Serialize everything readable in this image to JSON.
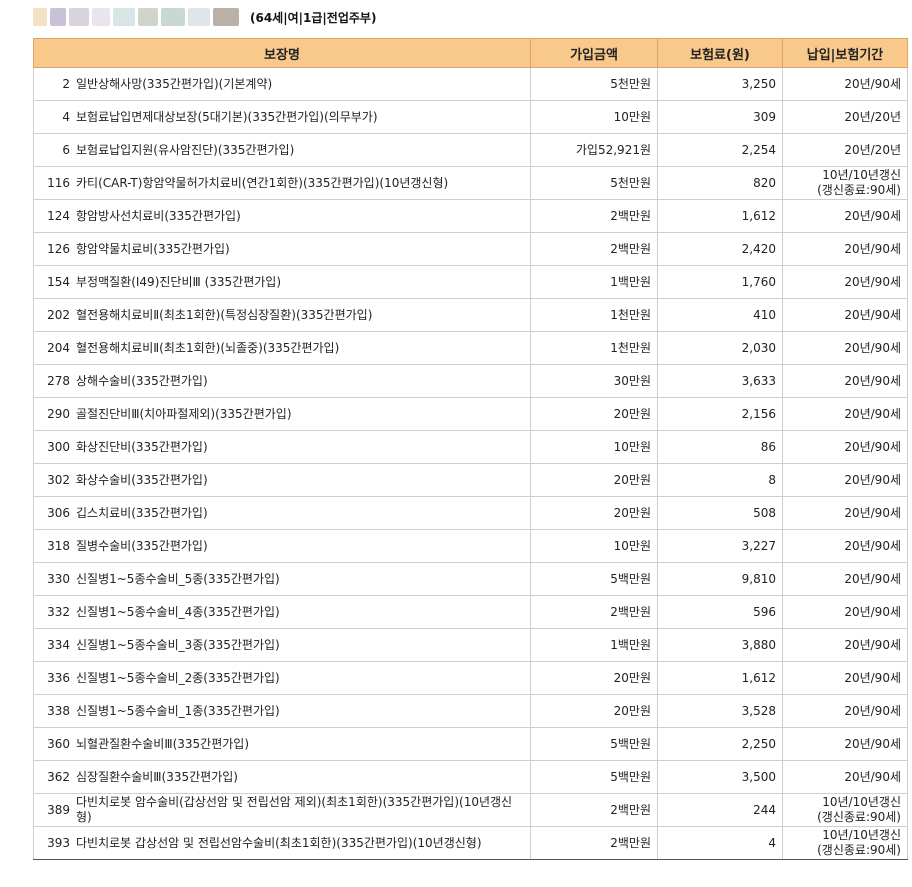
{
  "header": {
    "profile_text": "(64세|여|1급|전업주부)"
  },
  "table": {
    "columns": [
      "보장명",
      "가입금액",
      "보험료(원)",
      "납입|보험기간"
    ],
    "rows": [
      {
        "code": "2",
        "name": "일반상해사망(335간편가입)(기본계약)",
        "amount": "5천만원",
        "premium": "3,250",
        "period": "20년/90세",
        "period2": ""
      },
      {
        "code": "4",
        "name": "보험료납입면제대상보장(5대기본)(335간편가입)(의무부가)",
        "amount": "10만원",
        "premium": "309",
        "period": "20년/20년",
        "period2": ""
      },
      {
        "code": "6",
        "name": "보험료납입지원(유사암진단)(335간편가입)",
        "amount": "가입52,921원",
        "premium": "2,254",
        "period": "20년/20년",
        "period2": ""
      },
      {
        "code": "116",
        "name": "카티(CAR-T)항암약물허가치료비(연간1회한)(335간편가입)(10년갱신형)",
        "amount": "5천만원",
        "premium": "820",
        "period": "10년/10년갱신",
        "period2": "(갱신종료:90세)"
      },
      {
        "code": "124",
        "name": "항암방사선치료비(335간편가입)",
        "amount": "2백만원",
        "premium": "1,612",
        "period": "20년/90세",
        "period2": ""
      },
      {
        "code": "126",
        "name": "항암약물치료비(335간편가입)",
        "amount": "2백만원",
        "premium": "2,420",
        "period": "20년/90세",
        "period2": ""
      },
      {
        "code": "154",
        "name": "부정맥질환(I49)진단비Ⅲ (335간편가입)",
        "amount": "1백만원",
        "premium": "1,760",
        "period": "20년/90세",
        "period2": ""
      },
      {
        "code": "202",
        "name": "혈전용해치료비Ⅱ(최초1회한)(특정심장질환)(335간편가입)",
        "amount": "1천만원",
        "premium": "410",
        "period": "20년/90세",
        "period2": ""
      },
      {
        "code": "204",
        "name": "혈전용해치료비Ⅱ(최초1회한)(뇌졸중)(335간편가입)",
        "amount": "1천만원",
        "premium": "2,030",
        "period": "20년/90세",
        "period2": ""
      },
      {
        "code": "278",
        "name": "상해수술비(335간편가입)",
        "amount": "30만원",
        "premium": "3,633",
        "period": "20년/90세",
        "period2": ""
      },
      {
        "code": "290",
        "name": "골절진단비Ⅲ(치아파절제외)(335간편가입)",
        "amount": "20만원",
        "premium": "2,156",
        "period": "20년/90세",
        "period2": ""
      },
      {
        "code": "300",
        "name": "화상진단비(335간편가입)",
        "amount": "10만원",
        "premium": "86",
        "period": "20년/90세",
        "period2": ""
      },
      {
        "code": "302",
        "name": "화상수술비(335간편가입)",
        "amount": "20만원",
        "premium": "8",
        "period": "20년/90세",
        "period2": ""
      },
      {
        "code": "306",
        "name": "깁스치료비(335간편가입)",
        "amount": "20만원",
        "premium": "508",
        "period": "20년/90세",
        "period2": ""
      },
      {
        "code": "318",
        "name": "질병수술비(335간편가입)",
        "amount": "10만원",
        "premium": "3,227",
        "period": "20년/90세",
        "period2": ""
      },
      {
        "code": "330",
        "name": "신질병1~5종수술비_5종(335간편가입)",
        "amount": "5백만원",
        "premium": "9,810",
        "period": "20년/90세",
        "period2": ""
      },
      {
        "code": "332",
        "name": "신질병1~5종수술비_4종(335간편가입)",
        "amount": "2백만원",
        "premium": "596",
        "period": "20년/90세",
        "period2": ""
      },
      {
        "code": "334",
        "name": "신질병1~5종수술비_3종(335간편가입)",
        "amount": "1백만원",
        "premium": "3,880",
        "period": "20년/90세",
        "period2": ""
      },
      {
        "code": "336",
        "name": "신질병1~5종수술비_2종(335간편가입)",
        "amount": "20만원",
        "premium": "1,612",
        "period": "20년/90세",
        "period2": ""
      },
      {
        "code": "338",
        "name": "신질병1~5종수술비_1종(335간편가입)",
        "amount": "20만원",
        "premium": "3,528",
        "period": "20년/90세",
        "period2": ""
      },
      {
        "code": "360",
        "name": "뇌혈관질환수술비Ⅲ(335간편가입)",
        "amount": "5백만원",
        "premium": "2,250",
        "period": "20년/90세",
        "period2": ""
      },
      {
        "code": "362",
        "name": "심장질환수술비Ⅲ(335간편가입)",
        "amount": "5백만원",
        "premium": "3,500",
        "period": "20년/90세",
        "period2": ""
      },
      {
        "code": "389",
        "name": "다빈치로봇 암수술비(갑상선암 및 전립선암 제외)(최초1회한)(335간편가입)(10년갱신형)",
        "amount": "2백만원",
        "premium": "244",
        "period": "10년/10년갱신",
        "period2": "(갱신종료:90세)"
      },
      {
        "code": "393",
        "name": "다빈치로봇 갑상선암 및 전립선암수술비(최초1회한)(335간편가입)(10년갱신형)",
        "amount": "2백만원",
        "premium": "4",
        "period": "10년/10년갱신",
        "period2": "(갱신종료:90세)"
      }
    ]
  }
}
